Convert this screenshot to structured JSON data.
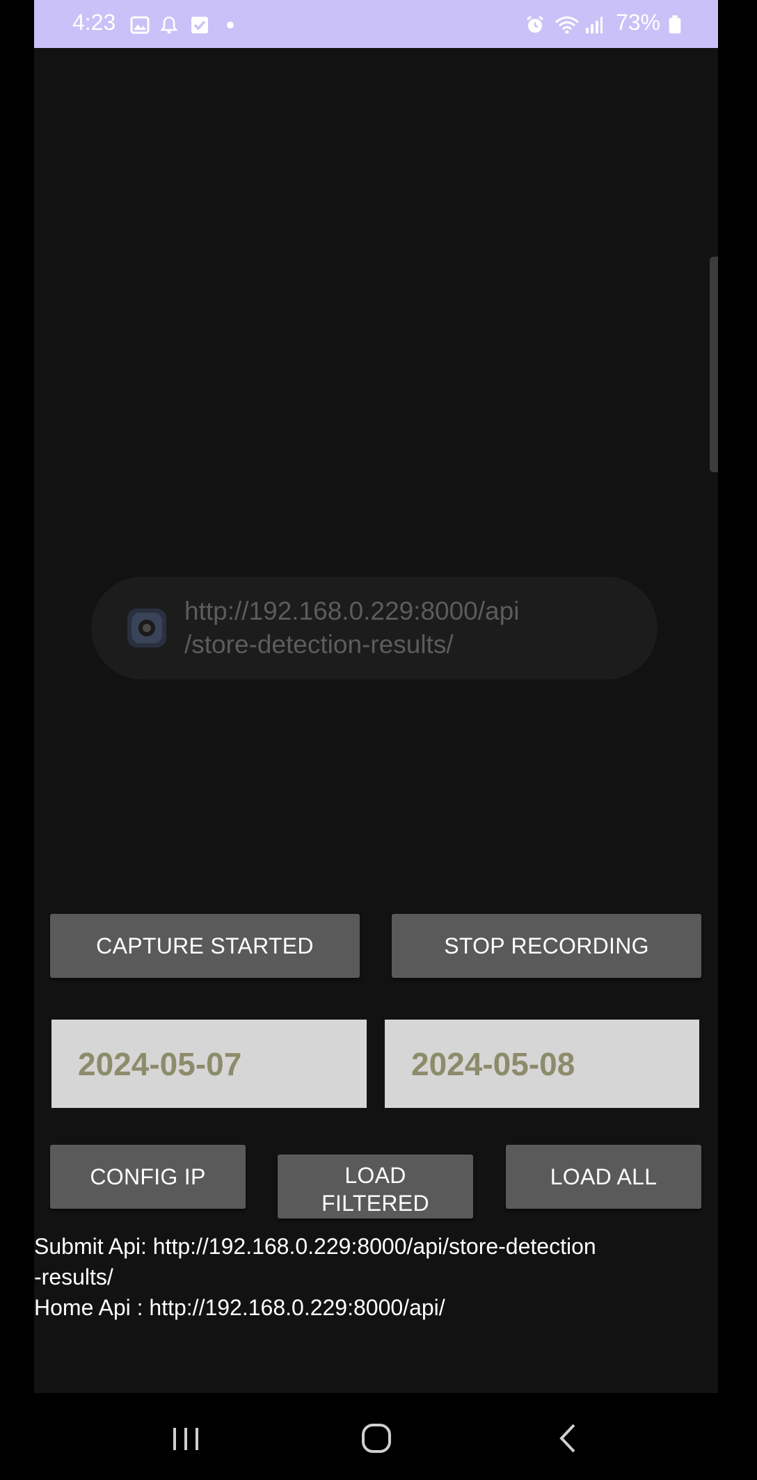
{
  "status_bar": {
    "time": "4:23",
    "battery_percent": "73%",
    "icons": [
      "gallery-icon",
      "notification-bell-icon",
      "checkbox-icon",
      "dot-icon",
      "alarm-icon",
      "wifi-icon",
      "signal-icon",
      "battery-icon"
    ],
    "background_color": "#c9c1f7"
  },
  "toast": {
    "icon": "camera-app-icon",
    "message": "http://192.168.0.229:8000/api\n/store-detection-results/"
  },
  "buttons": {
    "capture": "CAPTURE STARTED",
    "stop": "STOP RECORDING",
    "config_ip": "CONFIG IP",
    "load_filtered": "LOAD\nFILTERED",
    "load_all": "LOAD ALL"
  },
  "dates": {
    "start": "2024-05-07",
    "end": "2024-05-08"
  },
  "api_info": {
    "submit_line_1": "Submit Api: http://192.168.0.229:8000/api/store-detection",
    "submit_line_2": "-results/",
    "home_line": "Home Api : http://192.168.0.229:8000/api/"
  },
  "nav_bar": {
    "icons": [
      "recents-icon",
      "home-icon",
      "back-icon"
    ]
  },
  "colors": {
    "app_background": "#121212",
    "button": "#5a5a5a",
    "date_field_bg": "#d6d6d6",
    "date_text": "#8c8c6c",
    "toast_bg": "#1c1c1c",
    "toast_text": "#5c5c5c"
  }
}
